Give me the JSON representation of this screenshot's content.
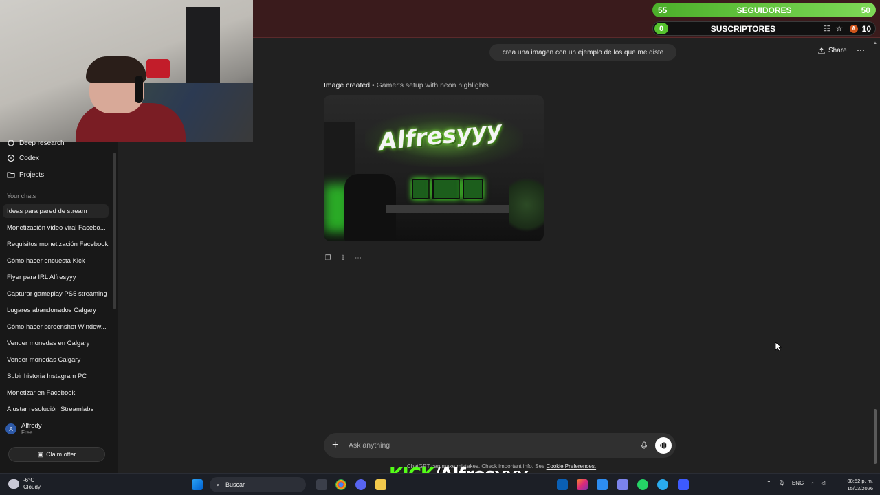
{
  "overlay": {
    "followers": {
      "left": "55",
      "label": "SEGUIDORES",
      "right": "50"
    },
    "subs": {
      "left": "0",
      "label": "SUSCRIPTORES",
      "avatar_letter": "A",
      "count": "10"
    }
  },
  "sidebar": {
    "top_items": [
      {
        "label": "Deep research",
        "icon": "telescope-icon"
      },
      {
        "label": "Codex",
        "icon": "codex-icon"
      },
      {
        "label": "Projects",
        "icon": "folder-icon"
      }
    ],
    "section_label": "Your chats",
    "chats": [
      "Ideas para pared de stream",
      "Monetización video viral Facebo...",
      "Requisitos monetización Facebook",
      "Cómo hacer encuesta Kick",
      "Flyer para IRL Alfresyyy",
      "Capturar gameplay PS5 streaming",
      "Lugares abandonados Calgary",
      "Cómo hacer screenshot Window...",
      "Vender monedas en Calgary",
      "Vender monedas Calgary",
      "Subir historia Instagram PC",
      "Monetizar en Facebook",
      "Ajustar resolución Streamlabs"
    ],
    "user": {
      "avatar": "A",
      "name": "Alfredy",
      "plan": "Free"
    },
    "claim_offer": "Claim offer"
  },
  "conversation": {
    "user_message": "crea una imagen con un ejemplo de los que me diste",
    "share_label": "Share",
    "image_status": "Image created",
    "image_title": "• Gamer's setup with neon highlights",
    "image_logo_text": "Alfresyyy"
  },
  "composer": {
    "placeholder": "Ask anything",
    "disclaimer_prefix": "ChatGPT can make mistakes. Check important info. See",
    "disclaimer_link": "Cookie Preferences."
  },
  "stream_overlay": {
    "kick": "KICK",
    "handle": "/Alfresyyy"
  },
  "taskbar": {
    "weather_temp": "-6°C",
    "weather_desc": "Cloudy",
    "search_label": "Buscar",
    "language": "ENG",
    "time": "08:52 p. m.",
    "date": "15/03/2026"
  },
  "colors": {
    "accent_green": "#53fc18",
    "counter_green": "#56c22e",
    "top_strip": "#3a1b1c"
  }
}
